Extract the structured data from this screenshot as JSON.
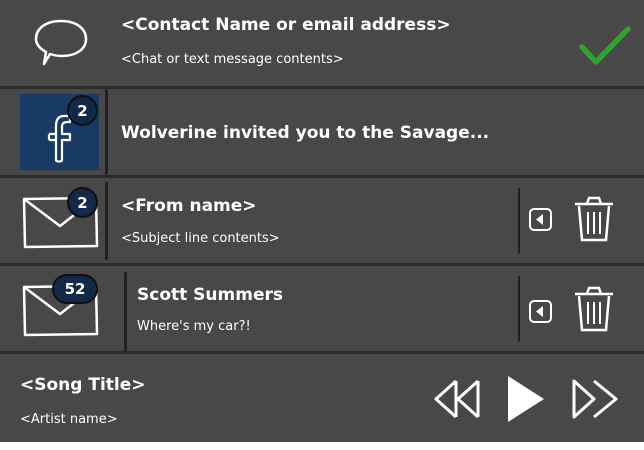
{
  "notifications": [
    {
      "type": "chat",
      "title": "<Contact Name or email address>",
      "subtitle": "<Chat or text message contents>",
      "icons": [
        "speech-bubble-icon",
        "checkmark-icon"
      ],
      "check_color": "#2fa32f"
    },
    {
      "type": "facebook",
      "badge": "2",
      "title": "Wolverine invited you to the Savage...",
      "icons": [
        "facebook-icon"
      ],
      "tile_color": "#1a3a66"
    },
    {
      "type": "email",
      "badge": "2",
      "title": "<From name>",
      "subtitle": "<Subject line contents>",
      "icons": [
        "envelope-icon",
        "left-arrow-icon",
        "trash-icon"
      ]
    },
    {
      "type": "email",
      "badge": "52",
      "title": "Scott Summers",
      "subtitle": "Where's my car?!",
      "icons": [
        "envelope-icon",
        "left-arrow-icon",
        "trash-icon"
      ]
    }
  ],
  "player": {
    "song_title": "<Song Title>",
    "artist": "<Artist name>",
    "icons": [
      "rewind-icon",
      "play-icon",
      "fast-forward-icon"
    ]
  },
  "colors": {
    "background": "#484848",
    "badge": "#13294a",
    "text": "#ffffff"
  }
}
